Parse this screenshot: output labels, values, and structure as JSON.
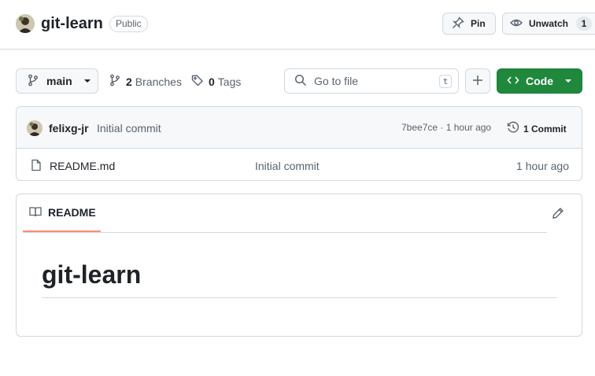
{
  "repo": {
    "name": "git-learn",
    "visibility": "Public"
  },
  "actions": {
    "pin_label": "Pin",
    "watch_label": "Unwatch",
    "watch_count": "1"
  },
  "toolbar": {
    "branch": "main",
    "branches_count": "2",
    "branches_label": "Branches",
    "tags_count": "0",
    "tags_label": "Tags",
    "search_placeholder": "Go to file",
    "search_shortcut": "t",
    "code_label": "Code"
  },
  "latest_commit": {
    "author": "felixg-jr",
    "message": "Initial commit",
    "meta": "7bee7ce · 1 hour ago",
    "count_label": "1 Commit"
  },
  "files": [
    {
      "name": "README.md",
      "commit": "Initial commit",
      "time": "1 hour ago"
    }
  ],
  "readme": {
    "tab_label": "README",
    "heading": "git-learn"
  },
  "colors": {
    "accent_green": "#1f883d",
    "tab_underline": "#fd8c73",
    "border": "#d1d9e0",
    "muted_text": "#59636e"
  },
  "icons": {
    "branch": "git-branch-icon",
    "tag": "tag-icon",
    "search": "search-icon",
    "add": "plus-icon",
    "code": "code-icon",
    "history": "history-icon",
    "file": "file-icon",
    "book": "book-icon",
    "edit": "pencil-icon",
    "pin": "pin-icon",
    "eye": "eye-icon"
  }
}
